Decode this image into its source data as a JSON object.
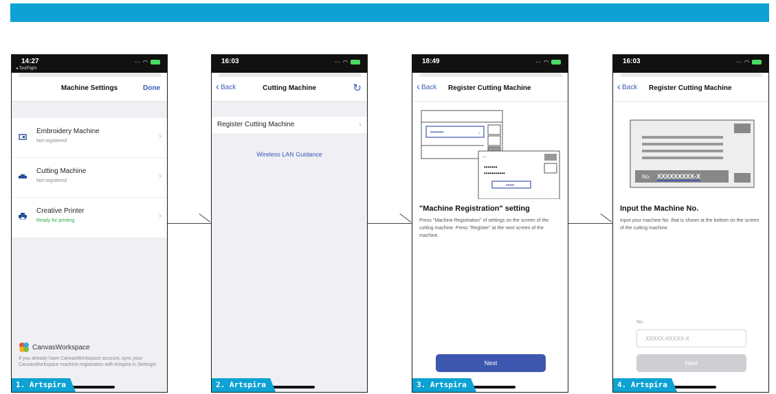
{
  "colors": {
    "accent": "#0da2d3",
    "ios_blue": "#3a5bb8",
    "button": "#3e57ae",
    "ok_green": "#27a845"
  },
  "screens": [
    {
      "step": "1.  Artspira",
      "time": "14:27",
      "back_app": "◂ TestFlight",
      "title": "Machine Settings",
      "done": "Done",
      "items": [
        {
          "title": "Embroidery Machine",
          "status": "Not registered",
          "icon": "embroidery-machine-icon"
        },
        {
          "title": "Cutting Machine",
          "status": "Not registered",
          "icon": "cutting-machine-icon"
        },
        {
          "title": "Creative Printer",
          "status": "Ready for printing",
          "icon": "printer-icon"
        }
      ],
      "cw_name": "CanvasWorkspace",
      "cw_note": "If you already have CanvasWorkspace account, sync your CanvasWorkspace machine registration with Artspira in Settings!"
    },
    {
      "step": "2.  Artspira",
      "time": "16:03",
      "back": "Back",
      "title": "Cutting Machine",
      "row": "Register Cutting Machine",
      "link": "Wireless LAN Guidance"
    },
    {
      "step": "3.  Artspira",
      "time": "18:49",
      "back": "Back",
      "title": "Register Cutting Machine",
      "heading": "\"Machine Registration\" setting",
      "body": "Press \"Machine Registration\" of settings on the screen of the cutting machine. Press \"Register\" at the next screen of the machine.",
      "next": "Next"
    },
    {
      "step": "4.  Artspira",
      "time": "16:03",
      "back": "Back",
      "title": "Register Cutting Machine",
      "plate_label": "No.",
      "plate_number": "XXXXXXXXX-X",
      "heading": "Input the Machine No.",
      "body": "Input your machine No. that is shown at the bottom on the screen of the cutting machine.",
      "field_label": "No.",
      "placeholder": "XXXXX-XXXXX-X",
      "next": "Next"
    }
  ]
}
